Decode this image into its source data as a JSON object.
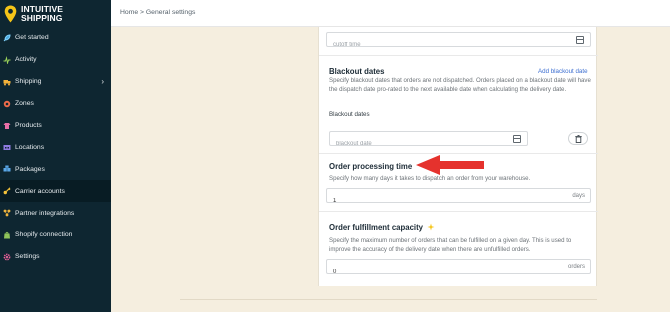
{
  "brand": {
    "line1": "INTUITIVE",
    "line2": "SHIPPING"
  },
  "sidebar": {
    "items": [
      {
        "label": "Get started",
        "icon": "rocket-icon"
      },
      {
        "label": "Activity",
        "icon": "activity-icon"
      },
      {
        "label": "Shipping",
        "icon": "shipping-icon",
        "has_chevron": true
      },
      {
        "label": "Zones",
        "icon": "zones-icon"
      },
      {
        "label": "Products",
        "icon": "products-icon"
      },
      {
        "label": "Locations",
        "icon": "locations-icon"
      },
      {
        "label": "Packages",
        "icon": "packages-icon"
      },
      {
        "label": "Carrier accounts",
        "icon": "key-icon",
        "active": true
      },
      {
        "label": "Partner integrations",
        "icon": "integrations-icon"
      },
      {
        "label": "Shopify connection",
        "icon": "shopify-icon"
      },
      {
        "label": "Settings",
        "icon": "gear-icon"
      }
    ]
  },
  "breadcrumb": "Home > General settings",
  "cutoff": {
    "placeholder": "cutoff time"
  },
  "blackout": {
    "title": "Blackout dates",
    "add_link": "Add blackout date",
    "description": "Specify blackout dates that orders are not dispatched. Orders placed on a blackout date will have the dispatch date pro-rated to the next available date when calculating the delivery date.",
    "field_label": "Blackout dates",
    "placeholder": "blackout date"
  },
  "processing": {
    "title": "Order processing time",
    "description": "Specify how many days it takes to dispatch an order from your warehouse.",
    "value": "1",
    "suffix": "days"
  },
  "capacity": {
    "title": "Order fulfillment capacity",
    "description": "Specify the maximum number of orders that can be fulfilled on a given day. This is used to improve the accuracy of the delivery date when there are unfulfilled orders.",
    "value": "0",
    "suffix": "orders"
  },
  "colors": {
    "sidebar_bg": "#0e2631",
    "page_bg": "#f5eedf",
    "link": "#3d6fd1",
    "arrow": "#e5322d",
    "logo_yellow": "#f5c518"
  }
}
